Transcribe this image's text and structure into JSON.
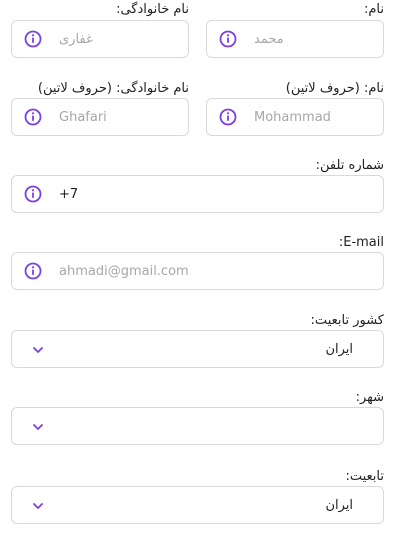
{
  "colors": {
    "accent": "#7b3fe4",
    "border": "#d9d9d9",
    "placeholder": "#a7a7a7",
    "text": "#222222"
  },
  "fields": {
    "first_name": {
      "label": "نام:",
      "placeholder": "محمد",
      "icon": "info-icon"
    },
    "last_name": {
      "label": "نام خانوادگی:",
      "placeholder": "غفاری",
      "icon": "info-icon"
    },
    "first_name_latin": {
      "label": "نام: (حروف لاتین)",
      "placeholder": "Mohammad",
      "icon": "info-icon"
    },
    "last_name_latin": {
      "label": "نام خانوادگی: (حروف لاتین)",
      "placeholder": "Ghafari",
      "icon": "info-icon"
    },
    "phone": {
      "label": "شماره تلفن:",
      "value": "+7",
      "icon": "info-icon"
    },
    "email": {
      "label": "E-mail:",
      "placeholder": "ahmadi@gmail.com",
      "icon": "info-icon"
    },
    "country": {
      "label": "کشور تابعیت:",
      "value": "ایران",
      "icon": "chevron-down-icon"
    },
    "city": {
      "label": "شهر:",
      "value": "",
      "icon": "chevron-down-icon"
    },
    "citizenship": {
      "label": "تابعیت:",
      "value": "ایران",
      "icon": "chevron-down-icon"
    }
  }
}
